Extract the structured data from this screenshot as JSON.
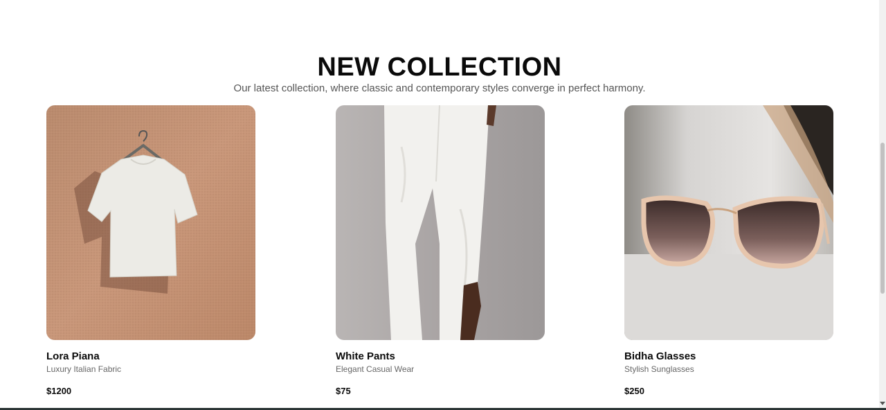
{
  "header": {
    "title": "NEW COLLECTION",
    "subtitle": "Our latest collection, where classic and contemporary styles converge in perfect harmony."
  },
  "products": [
    {
      "name": "Lora Piana",
      "description": "Luxury Italian Fabric",
      "price": "$1200",
      "image": "white-tshirt-on-hanger"
    },
    {
      "name": "White Pants",
      "description": "Elegant Casual Wear",
      "price": "$75",
      "image": "white-pants"
    },
    {
      "name": "Bidha Glasses",
      "description": "Stylish Sunglasses",
      "price": "$250",
      "image": "cat-eye-sunglasses"
    }
  ]
}
